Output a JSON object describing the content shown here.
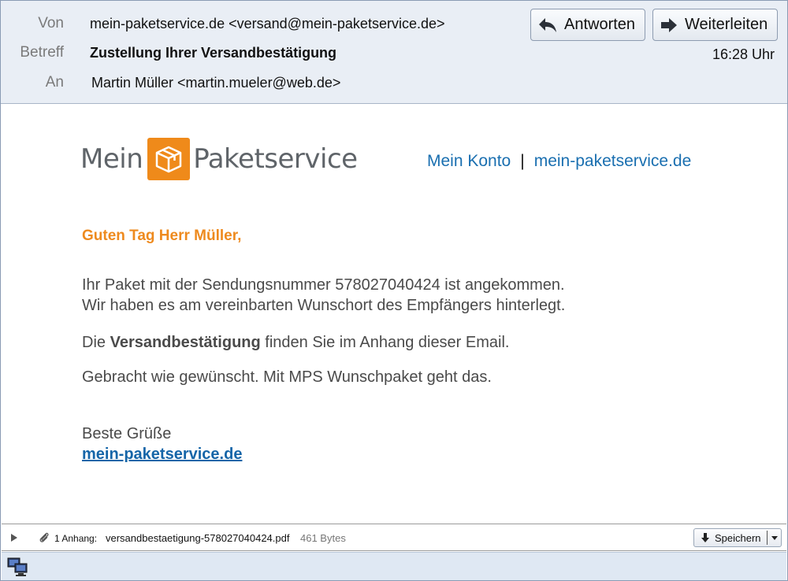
{
  "header": {
    "from_label": "Von",
    "from_value": "mein-paketservice.de <versand@mein-paketservice.de>",
    "subject_label": "Betreff",
    "subject_value": "Zustellung Ihrer Versandbestätigung",
    "to_label": "An",
    "to_value": "Martin Müller <martin.mueler@web.de>",
    "reply_label": "Antworten",
    "forward_label": "Weiterleiten",
    "time": "16:28 Uhr"
  },
  "logo": {
    "word1": "Mein",
    "word2": "Paketservice",
    "brand_color": "#ef8a1a"
  },
  "toplinks": {
    "account": "Mein Konto",
    "site": "mein-paketservice.de"
  },
  "body": {
    "greeting": "Guten Tag Herr Müller,",
    "line1": "Ihr Paket mit der Sendungsnummer 578027040424 ist angekommen.",
    "line2": "Wir haben es am vereinbarten Wunschort des Empfängers hinterlegt.",
    "line3_pre": "Die ",
    "line3_bold": "Versandbestätigung",
    "line3_post": " finden Sie im Anhang dieser Email.",
    "line4": "Gebracht wie gewünscht. Mit MPS Wunschpaket geht das.",
    "closing": "Beste Grüße",
    "site_link": "mein-paketservice.de"
  },
  "attachment": {
    "count_label": "1 Anhang:",
    "filename": "versandbestaetigung-578027040424.pdf",
    "size": "461 Bytes",
    "save_label": "Speichern"
  }
}
